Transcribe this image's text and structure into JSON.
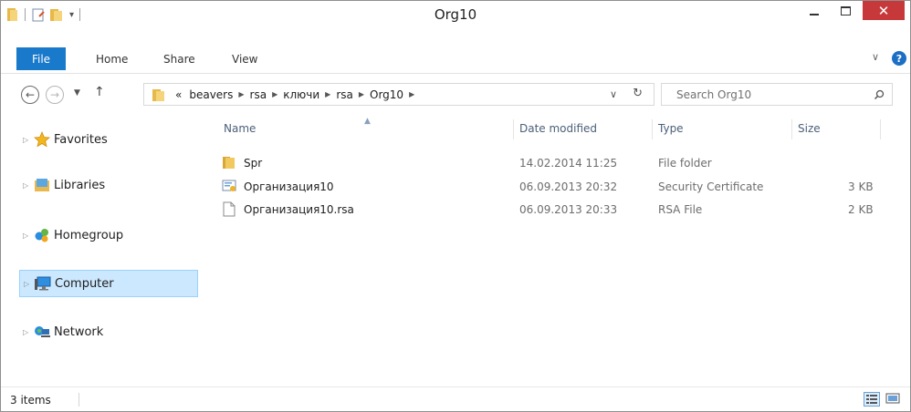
{
  "window": {
    "title": "Org10"
  },
  "ribbon": {
    "tabs": {
      "file": "File",
      "home": "Home",
      "share": "Share",
      "view": "View"
    }
  },
  "address": {
    "overflow": "«",
    "crumbs": [
      "beavers",
      "rsa",
      "ключи",
      "rsa",
      "Org10"
    ]
  },
  "search": {
    "placeholder": "Search Org10"
  },
  "nav": {
    "items": [
      {
        "label": "Favorites",
        "icon": "star-icon"
      },
      {
        "label": "Libraries",
        "icon": "libraries-icon"
      },
      {
        "label": "Homegroup",
        "icon": "homegroup-icon"
      },
      {
        "label": "Computer",
        "icon": "computer-icon"
      },
      {
        "label": "Network",
        "icon": "network-icon"
      }
    ]
  },
  "columns": {
    "name": "Name",
    "date": "Date modified",
    "type": "Type",
    "size": "Size"
  },
  "files": [
    {
      "name": "Spr",
      "date": "14.02.2014 11:25",
      "type": "File folder",
      "size": "",
      "icon": "folder-icon"
    },
    {
      "name": "Организация10",
      "date": "06.09.2013 20:32",
      "type": "Security Certificate",
      "size": "3 KB",
      "icon": "certificate-icon"
    },
    {
      "name": "Организация10.rsa",
      "date": "06.09.2013 20:33",
      "type": "RSA File",
      "size": "2 KB",
      "icon": "file-icon"
    }
  ],
  "status": {
    "items": "3 items"
  },
  "colors": {
    "accent": "#1979ca",
    "close": "#c7383b",
    "selection": "#cce8ff"
  }
}
